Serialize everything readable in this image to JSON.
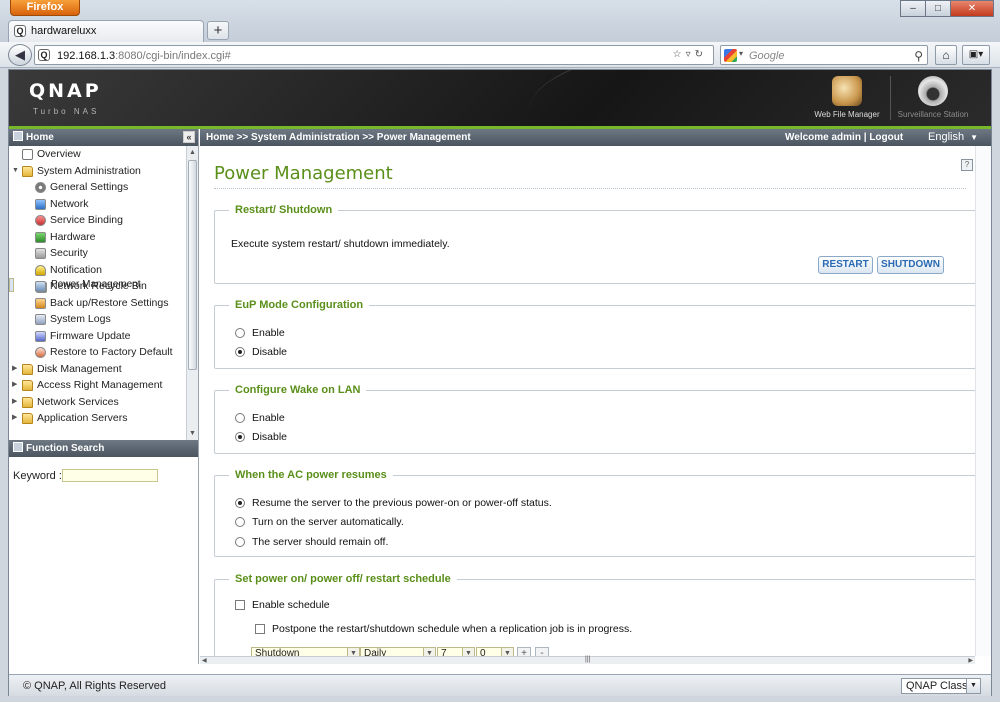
{
  "browser": {
    "menu_button": "Firefox",
    "window_buttons": {
      "minimize": "–",
      "maximize": "□",
      "close": "✕"
    },
    "tab_title": "hardwareluxx",
    "new_tab": "+",
    "url_host": "192.168.1.3",
    "url_rest": ":8080/cgi-bin/index.cgi#",
    "search_placeholder": "Google"
  },
  "header": {
    "logo": "QNAP",
    "logo_sub": "Turbo NAS",
    "apps": [
      {
        "label": "Web File Manager",
        "icon": "web-file-manager-icon"
      },
      {
        "label": "Surveillance Station",
        "icon": "surveillance-camera-icon"
      }
    ]
  },
  "sidebar": {
    "header": "Home",
    "items": [
      {
        "label": "Overview",
        "icon": "doc",
        "level": 1,
        "arrow": ""
      },
      {
        "label": "System Administration",
        "icon": "folder",
        "level": 1,
        "arrow": "▼"
      },
      {
        "label": "General Settings",
        "icon": "gear",
        "level": 2,
        "arrow": ""
      },
      {
        "label": "Network",
        "icon": "net",
        "level": 2,
        "arrow": ""
      },
      {
        "label": "Service Binding",
        "icon": "svc",
        "level": 2,
        "arrow": ""
      },
      {
        "label": "Hardware",
        "icon": "hw",
        "level": 2,
        "arrow": ""
      },
      {
        "label": "Security",
        "icon": "lock",
        "level": 2,
        "arrow": ""
      },
      {
        "label": "Notification",
        "icon": "bell",
        "level": 2,
        "arrow": ""
      },
      {
        "label": "Power Management",
        "icon": "pow",
        "level": 2,
        "arrow": "",
        "selected": true
      },
      {
        "label": "Network Recycle Bin",
        "icon": "bin",
        "level": 2,
        "arrow": ""
      },
      {
        "label": "Back up/Restore Settings",
        "icon": "bak",
        "level": 2,
        "arrow": ""
      },
      {
        "label": "System Logs",
        "icon": "log",
        "level": 2,
        "arrow": ""
      },
      {
        "label": "Firmware Update",
        "icon": "fw",
        "level": 2,
        "arrow": ""
      },
      {
        "label": "Restore to Factory Default",
        "icon": "rst",
        "level": 2,
        "arrow": ""
      },
      {
        "label": "Disk Management",
        "icon": "folder",
        "level": 1,
        "arrow": "▶"
      },
      {
        "label": "Access Right Management",
        "icon": "folder",
        "level": 1,
        "arrow": "▶"
      },
      {
        "label": "Network Services",
        "icon": "folder",
        "level": 1,
        "arrow": "▶"
      },
      {
        "label": "Application Servers",
        "icon": "folder",
        "level": 1,
        "arrow": "▶"
      }
    ],
    "function_search": "Function Search",
    "keyword_label": "Keyword :",
    "keyword_value": ""
  },
  "topbar": {
    "breadcrumb": "Home >> System Administration >> Power Management",
    "welcome_prefix": "Welcome admin | ",
    "logout": "Logout",
    "language": "English"
  },
  "main": {
    "title": "Power Management",
    "restart_shutdown": {
      "legend": "Restart/ Shutdown",
      "description": "Execute system restart/ shutdown immediately.",
      "restart_label": "RESTART",
      "shutdown_label": "SHUTDOWN"
    },
    "eup": {
      "legend": "EuP Mode Configuration",
      "options": [
        "Enable",
        "Disable"
      ],
      "selected": "Disable"
    },
    "wol": {
      "legend": "Configure Wake on LAN",
      "options": [
        "Enable",
        "Disable"
      ],
      "selected": "Disable"
    },
    "ac_power": {
      "legend": "When the AC power resumes",
      "options": [
        "Resume the server to the previous power-on or power-off status.",
        "Turn on the server automatically.",
        "The server should remain off."
      ],
      "selected": "Resume the server to the previous power-on or power-off status."
    },
    "schedule": {
      "legend": "Set power on/ power off/ restart schedule",
      "enable_label": "Enable schedule",
      "enable_checked": false,
      "postpone_label": "Postpone the restart/shutdown schedule when a replication job is in progress.",
      "postpone_checked": false,
      "action_value": "Shutdown",
      "frequency_value": "Daily",
      "hour_value": "7",
      "minute_value": "0",
      "add_label": "+",
      "remove_label": "-"
    }
  },
  "footer": {
    "copyright": "© QNAP, All Rights Reserved",
    "theme_value": "QNAP Classic"
  },
  "colors": {
    "accent_green": "#5a8f1a",
    "header_bar": "#4b5560",
    "button_text": "#2a6ab3"
  }
}
